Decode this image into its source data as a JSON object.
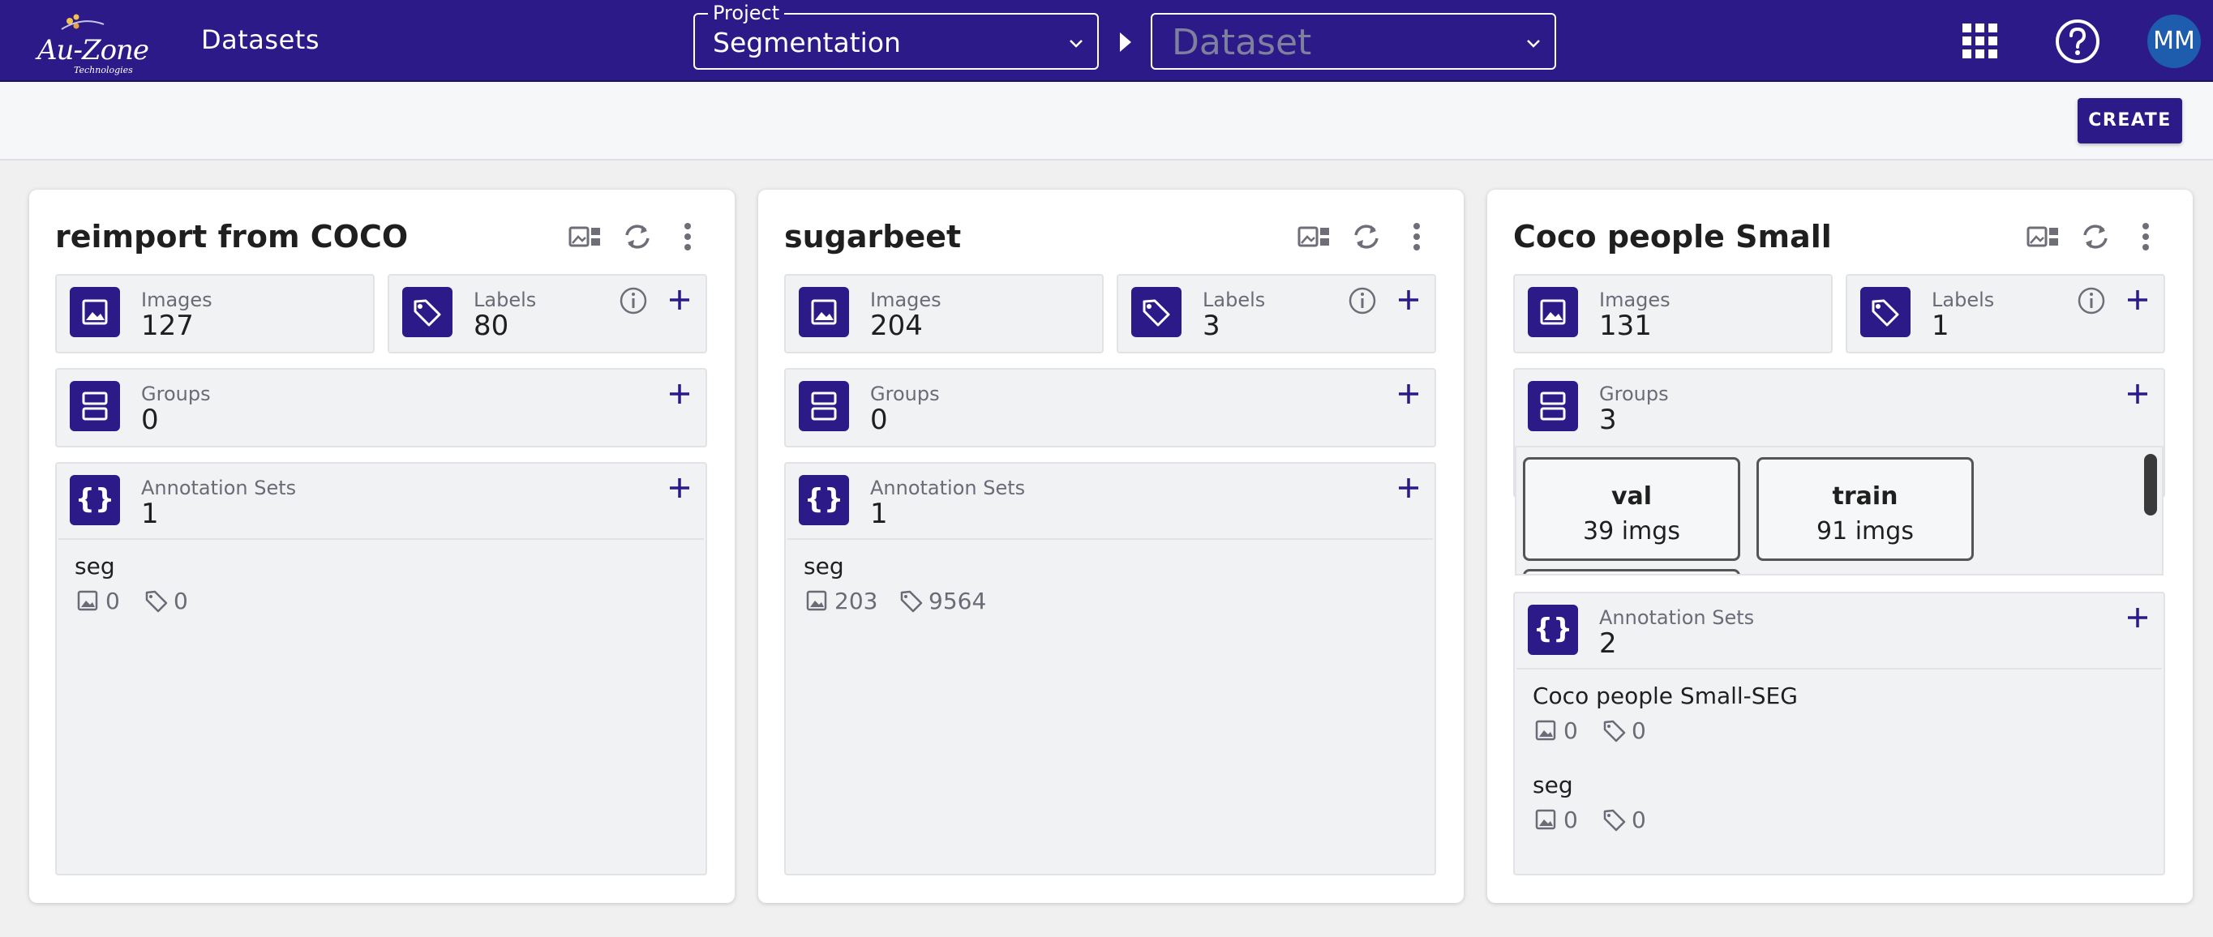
{
  "header": {
    "logo_text": "Au-Zone",
    "logo_subtext": "Technologies",
    "nav_title": "Datasets",
    "project_legend": "Project",
    "project_value": "Segmentation",
    "dataset_placeholder": "Dataset",
    "avatar_initials": "MM",
    "colors": {
      "bar": "#2b1a87",
      "accent": "#2b1a87"
    }
  },
  "toolbar": {
    "create_label": "CREATE"
  },
  "cards": [
    {
      "title": "reimport from COCO",
      "images_label": "Images",
      "images_value": "127",
      "labels_label": "Labels",
      "labels_value": "80",
      "groups_label": "Groups",
      "groups_value": "0",
      "annotations_label": "Annotation Sets",
      "annotations_value": "1",
      "annotation_sets": [
        {
          "name": "seg",
          "images": "0",
          "labels": "0"
        }
      ]
    },
    {
      "title": "sugarbeet",
      "images_label": "Images",
      "images_value": "204",
      "labels_label": "Labels",
      "labels_value": "3",
      "groups_label": "Groups",
      "groups_value": "0",
      "annotations_label": "Annotation Sets",
      "annotations_value": "1",
      "annotation_sets": [
        {
          "name": "seg",
          "images": "203",
          "labels": "9564"
        }
      ]
    },
    {
      "title": "Coco people Small",
      "images_label": "Images",
      "images_value": "131",
      "labels_label": "Labels",
      "labels_value": "1",
      "groups_label": "Groups",
      "groups_value": "3",
      "groups": [
        {
          "name": "val",
          "count": "39 imgs"
        },
        {
          "name": "train",
          "count": "91 imgs"
        }
      ],
      "annotations_label": "Annotation Sets",
      "annotations_value": "2",
      "annotation_sets": [
        {
          "name": "Coco people Small-SEG",
          "images": "0",
          "labels": "0"
        },
        {
          "name": "seg",
          "images": "0",
          "labels": "0"
        }
      ]
    }
  ]
}
